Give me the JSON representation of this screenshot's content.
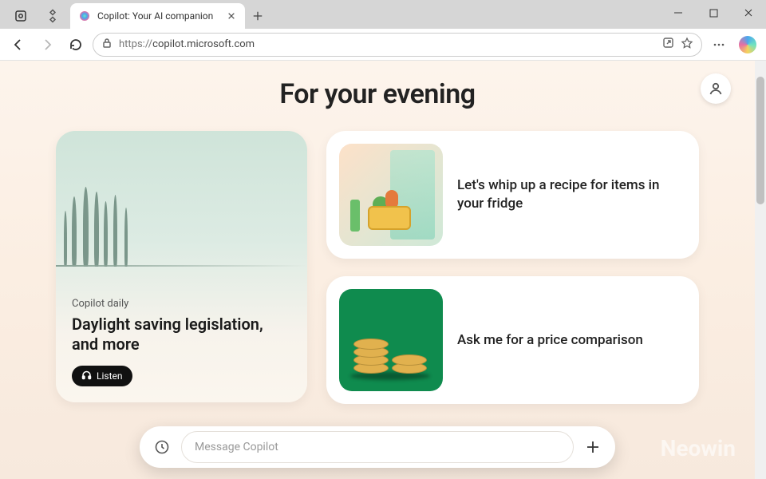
{
  "browser": {
    "tab_title": "Copilot: Your AI companion",
    "url_protocol": "https://",
    "url_host": "copilot.microsoft.com"
  },
  "page": {
    "headline": "For your evening"
  },
  "daily_card": {
    "label": "Copilot daily",
    "title": "Daylight saving legislation, and more",
    "listen_label": "Listen"
  },
  "cards": [
    {
      "text": "Let's whip up a recipe for items in your fridge"
    },
    {
      "text": "Ask me for a price comparison"
    }
  ],
  "compose": {
    "placeholder": "Message Copilot"
  },
  "watermark": "Neowin"
}
